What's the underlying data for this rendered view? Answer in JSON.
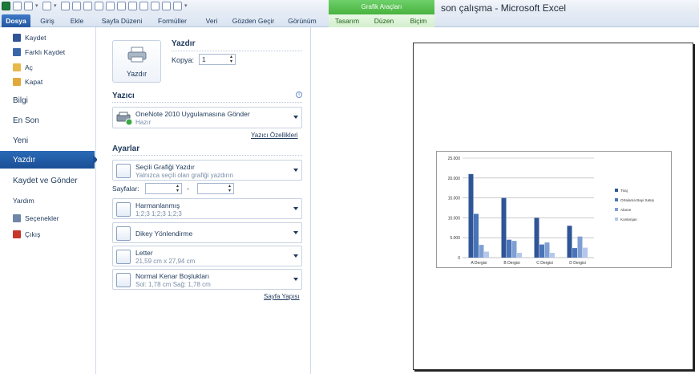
{
  "window": {
    "title": "son çalışma  -  Microsoft Excel",
    "context_group": "Grafik Araçları"
  },
  "ribbon": {
    "tabs": [
      "Dosya",
      "Giriş",
      "Ekle",
      "Sayfa Düzeni",
      "Formüller",
      "Veri",
      "Gözden Geçir",
      "Görünüm",
      "Tasarım",
      "Düzen",
      "Biçim"
    ]
  },
  "nav": {
    "items": [
      {
        "label": "Kaydet",
        "icon": "save-icon"
      },
      {
        "label": "Farklı Kaydet",
        "icon": "save-as-icon"
      },
      {
        "label": "Aç",
        "icon": "open-folder-icon"
      },
      {
        "label": "Kapat",
        "icon": "close-folder-icon"
      },
      {
        "label": "Bilgi"
      },
      {
        "label": "En Son"
      },
      {
        "label": "Yeni"
      },
      {
        "label": "Yazdır"
      },
      {
        "label": "Kaydet ve Gönder"
      },
      {
        "label": "Yardım"
      },
      {
        "label": "Seçenekler",
        "icon": "options-icon"
      },
      {
        "label": "Çıkış",
        "icon": "exit-icon"
      }
    ]
  },
  "print": {
    "section_title": "Yazdır",
    "print_button": "Yazdır",
    "copies_label": "Kopya:",
    "copies_value": "1",
    "printer_section": "Yazıcı",
    "printer_name": "OneNote 2010 Uygulamasına Gönder",
    "printer_status": "Hazır",
    "printer_properties_link": "Yazıcı Özellikleri",
    "settings_section": "Ayarlar",
    "options": [
      {
        "line1": "Seçili Grafiği Yazdır",
        "line2": "Yalnızca seçili olan grafiği yazdırın"
      },
      {
        "line1": "Harmanlanmış",
        "line2": "1;2;3    1;2;3    1;2;3"
      },
      {
        "line1": "Dikey Yönlendirme",
        "line2": ""
      },
      {
        "line1": "Letter",
        "line2": "21,59 cm x 27,94 cm"
      },
      {
        "line1": "Normal Kenar Boşlukları",
        "line2": "Sol:  1,78 cm    Sağ:  1,78 cm"
      }
    ],
    "pages_label": "Sayfalar:",
    "pages_dash": "-",
    "page_setup_link": "Sayfa Yapısı"
  },
  "chart_data": {
    "type": "bar",
    "categories": [
      "A Dergisi",
      "B Dergisi",
      "C Dergisi",
      "D Dergisi"
    ],
    "series": [
      {
        "name": "Tiraj",
        "values": [
          21000,
          15000,
          10000,
          8000
        ],
        "color": "#2f5597"
      },
      {
        "name": "Ortalama Bayi Satışı",
        "values": [
          11000,
          4500,
          3300,
          2400
        ],
        "color": "#4a74b8"
      },
      {
        "name": "Abone",
        "values": [
          3200,
          4200,
          3800,
          5300
        ],
        "color": "#7e9fd3"
      },
      {
        "name": "Kontenjan",
        "values": [
          1500,
          1200,
          1200,
          2500
        ],
        "color": "#b4c7ea"
      }
    ],
    "yticks": [
      "0",
      "5.000",
      "10.000",
      "15.000",
      "20.000",
      "25.000"
    ],
    "ylim": [
      0,
      25000
    ],
    "legend": "right",
    "grid": true
  }
}
